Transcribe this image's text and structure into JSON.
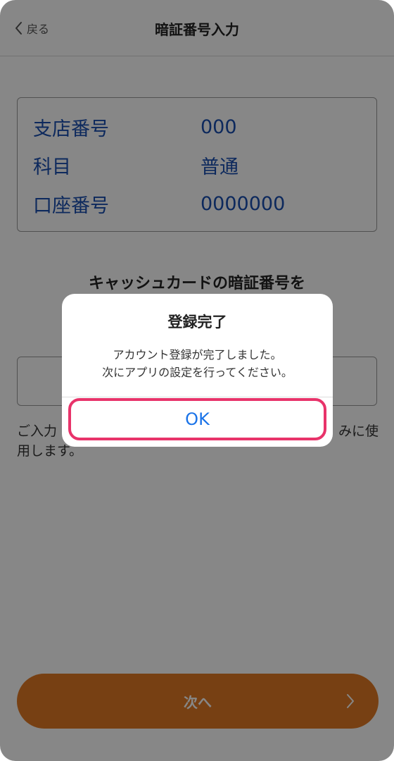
{
  "nav": {
    "back_label": "戻る",
    "title": "暗証番号入力"
  },
  "account_info": {
    "rows": [
      {
        "label": "支店番号",
        "value": "000"
      },
      {
        "label": "科目",
        "value": "普通"
      },
      {
        "label": "口座番号",
        "value": "0000000"
      }
    ]
  },
  "prompt": {
    "text": "キャッシュカードの暗証番号を"
  },
  "pin_input": {
    "value": ""
  },
  "note": {
    "line1_left": "ご入力",
    "line1_right": "みに使",
    "line2": "用します。"
  },
  "next_button": {
    "label": "次へ"
  },
  "dialog": {
    "title": "登録完了",
    "message_line1": "アカウント登録が完了しました。",
    "message_line2": "次にアプリの設定を行ってください。",
    "ok_label": "OK"
  },
  "colors": {
    "accent_orange": "#e07a24",
    "link_blue": "#1a73e8",
    "info_blue": "#1a4fb0",
    "highlight_pink": "#e8336a"
  },
  "icons": {
    "back": "chevron-left-icon",
    "next": "chevron-right-icon"
  }
}
